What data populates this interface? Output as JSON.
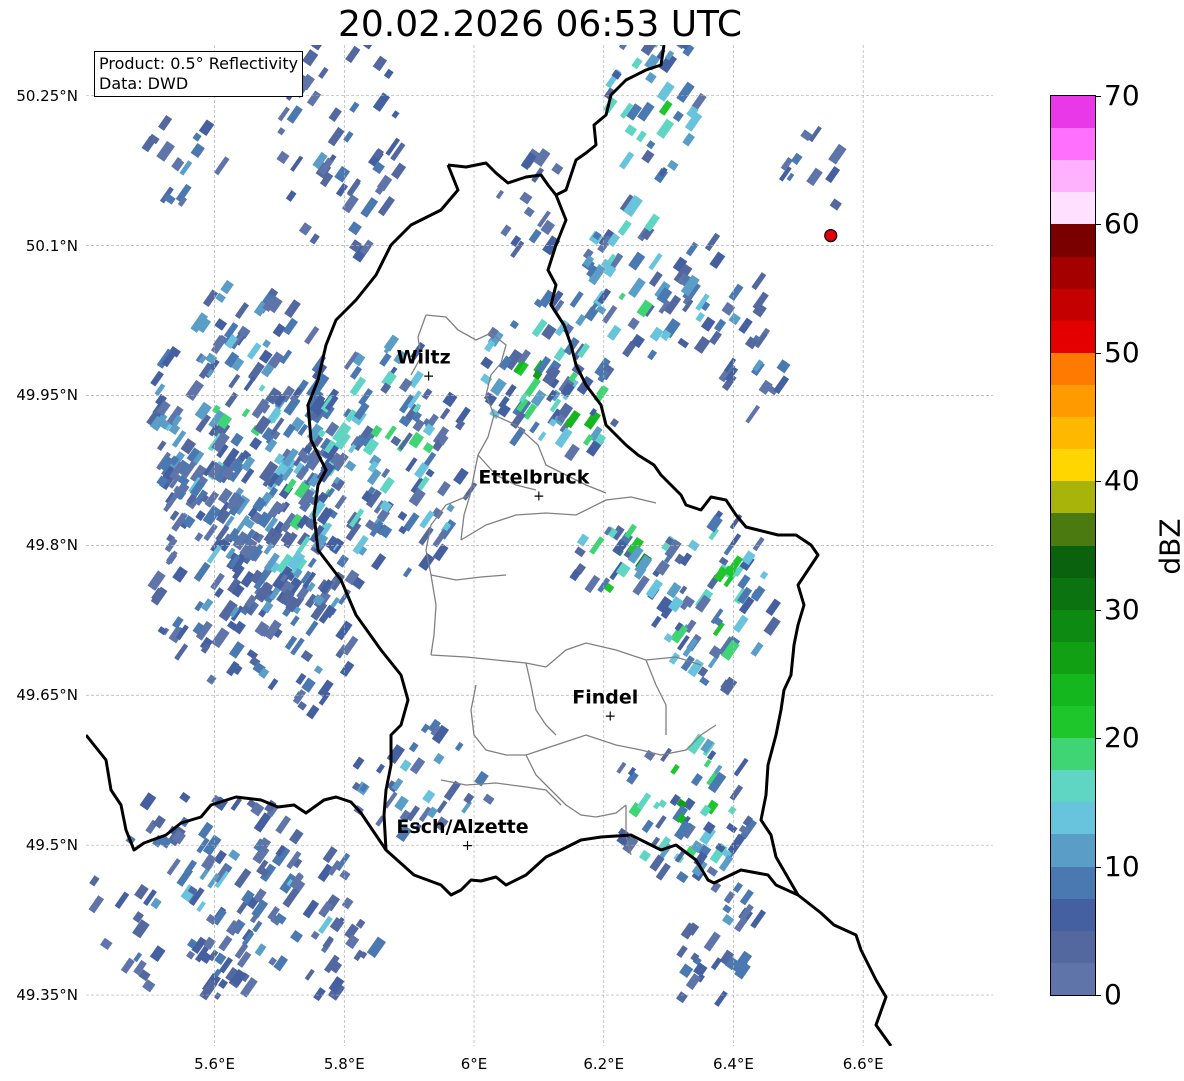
{
  "title": "20.02.2026 06:53 UTC",
  "info": {
    "product": "Product: 0.5° Reflectivity",
    "source": "Data: DWD"
  },
  "map": {
    "lon_range": [
      5.4,
      6.8
    ],
    "lat_range": [
      49.3,
      50.3
    ],
    "lat_ticks": [
      "50.25°N",
      "50.1°N",
      "49.95°N",
      "49.8°N",
      "49.65°N",
      "49.5°N",
      "49.35°N"
    ],
    "lon_ticks": [
      "5.6°E",
      "5.8°E",
      "6°E",
      "6.2°E",
      "6.4°E",
      "6.6°E"
    ],
    "grid": true,
    "cities": [
      {
        "name": "Wiltz",
        "lon": 5.93,
        "lat": 49.97
      },
      {
        "name": "Ettelbruck",
        "lon": 6.1,
        "lat": 49.85
      },
      {
        "name": "Findel",
        "lon": 6.21,
        "lat": 49.63
      },
      {
        "name": "Esch/Alzette",
        "lon": 5.99,
        "lat": 49.5
      }
    ],
    "radar_marker": {
      "lon": 6.55,
      "lat": 50.11,
      "color": "#e3000f"
    }
  },
  "colorbar": {
    "label": "dBZ",
    "tick_labels": [
      "70",
      "60",
      "50",
      "40",
      "30",
      "20",
      "10",
      "0"
    ],
    "range": [
      0,
      70
    ],
    "colors": [
      "#5f74a8",
      "#53689f",
      "#4560a0",
      "#4a78b0",
      "#5a9ec8",
      "#68c3dc",
      "#5fd6c4",
      "#3fd574",
      "#1ec62c",
      "#14b71e",
      "#119f14",
      "#0d8a12",
      "#0b7410",
      "#0a620e",
      "#4a7a10",
      "#a9b40a",
      "#ffd600",
      "#ffb800",
      "#ff9a00",
      "#ff7a00",
      "#e50000",
      "#c50000",
      "#a40000",
      "#7a0000",
      "#ffe0ff",
      "#ffb0ff",
      "#ff70ff",
      "#e838e8"
    ]
  }
}
